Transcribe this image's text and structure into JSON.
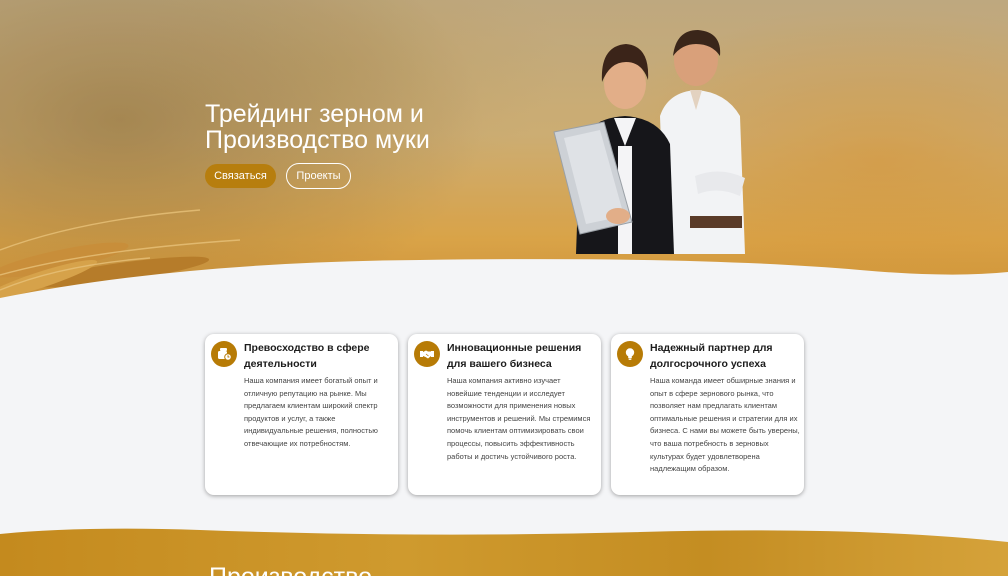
{
  "hero": {
    "title_line1": "Трейдинг зерном и",
    "title_line2": "Производство муки",
    "contact_button": "Связаться",
    "projects_button": "Проекты"
  },
  "features": [
    {
      "icon": "coins-clock-icon",
      "title": "Превосходство в сфере деятельности",
      "text": "Наша компания имеет богатый опыт и отличную репутацию на рынке. Мы предлагаем клиентам широкий спектр продуктов и услуг, а также индивидуальные решения, полностью отвечающие их потребностям."
    },
    {
      "icon": "handshake-icon",
      "title": "Инновационные решения для вашего бизнеса",
      "text": "Наша компания активно изучает новейшие тенденции и исследует возможности для применения новых инструментов и решений. Мы стремимся помочь клиентам оптимизировать свои процессы, повысить эффективность работы и достичь устойчивого роста."
    },
    {
      "icon": "lightbulb-icon",
      "title": "Надежный партнер для долгосрочного успеха",
      "text": "Наша команда имеет обширные знания и опыт в сфере зернового рынка, что позволяет нам предлагать клиентам оптимальные решения и стратегии для их бизнеса. С нами вы можете быть уверены, что ваша потребность в зерновых культурах будет удовлетворена надлежащим образом."
    }
  ],
  "next_section": {
    "title": "Производство"
  },
  "colors": {
    "accent": "#b77b06",
    "background": "#f4f5f7"
  }
}
